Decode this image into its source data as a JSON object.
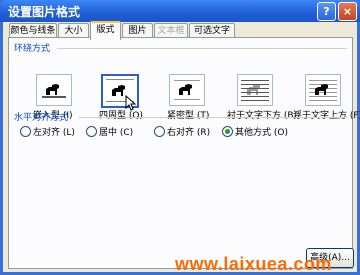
{
  "window": {
    "title": "设置图片格式",
    "help_glyph": "?",
    "close_glyph": "×"
  },
  "tabs": [
    {
      "label": "颜色与线条"
    },
    {
      "label": "大小"
    },
    {
      "label": "版式"
    },
    {
      "label": "图片"
    },
    {
      "label": "文本框"
    },
    {
      "label": "可选文字"
    }
  ],
  "wrap_section": {
    "title": "环绕方式",
    "options": [
      {
        "label": "嵌入型 (I)"
      },
      {
        "label": "四周型 (Q)"
      },
      {
        "label": "紧密型 (T)"
      },
      {
        "label": "衬于文字下方 (B)"
      },
      {
        "label": "浮于文字上方 (F)"
      }
    ],
    "selected_index": 1
  },
  "align_section": {
    "title": "水平对齐方式",
    "options": [
      {
        "label": "左对齐 (L)"
      },
      {
        "label": "居中 (C)"
      },
      {
        "label": "右对齐 (R)"
      },
      {
        "label": "其他方式 (O)"
      }
    ],
    "selected_index": 3
  },
  "advanced_button": {
    "label": "高级(A)..."
  },
  "watermark": {
    "text": "www.laixuea.com"
  }
}
